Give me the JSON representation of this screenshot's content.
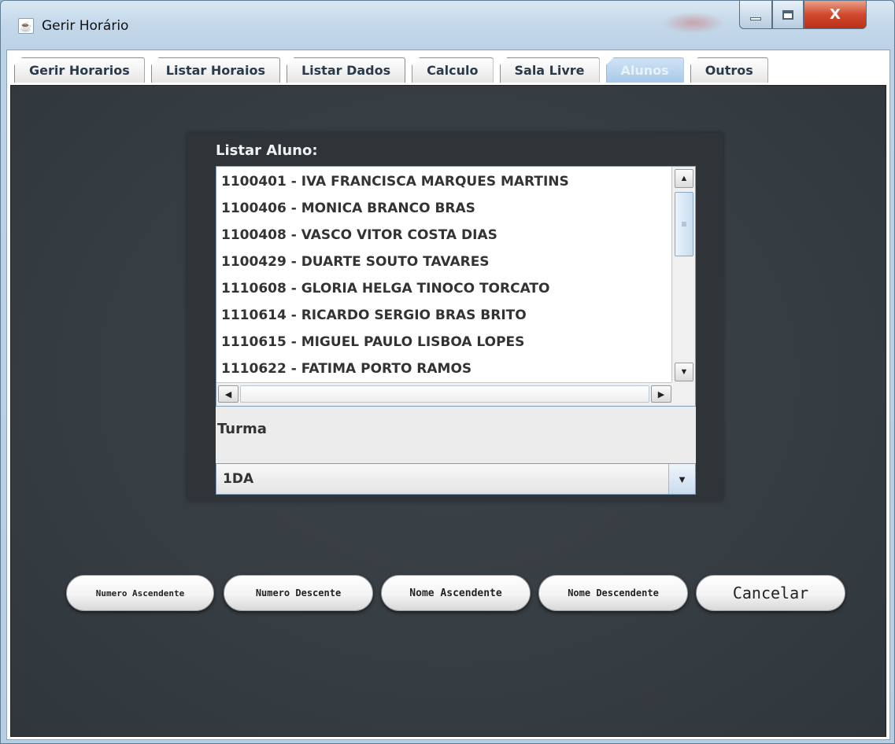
{
  "window": {
    "title": "Gerir Horário",
    "app_icon": "java-coffee-icon",
    "controls": {
      "close_glyph": "X"
    }
  },
  "tabs": [
    {
      "label": "Gerir Horarios",
      "active": false
    },
    {
      "label": "Listar Horaios",
      "active": false
    },
    {
      "label": "Listar Dados",
      "active": false
    },
    {
      "label": "Calculo",
      "active": false
    },
    {
      "label": "Sala Livre",
      "active": false
    },
    {
      "label": "Alunos",
      "active": true
    },
    {
      "label": "Outros",
      "active": false
    }
  ],
  "alunos": {
    "list_label": "Listar Aluno:",
    "students": [
      "1100401 - IVA FRANCISCA MARQUES MARTINS",
      "1100406 - MONICA BRANCO BRAS",
      "1100408 - VASCO VITOR COSTA DIAS",
      "1100429 - DUARTE SOUTO TAVARES",
      "1110608 - GLORIA HELGA TINOCO TORCATO",
      "1110614 - RICARDO SERGIO BRAS BRITO",
      "1110615 - MIGUEL PAULO LISBOA LOPES",
      "1110622 - FATIMA PORTO RAMOS"
    ],
    "turma_label": "Turma",
    "turma_value": "1DA"
  },
  "buttons": {
    "numero_ascendente": "Numero Ascendente",
    "numero_descente": "Numero Descente",
    "nome_ascendente": "Nome Ascendente",
    "nome_descendente": "Nome Descendente",
    "cancelar": "Cancelar"
  },
  "colors": {
    "panel_background": "#363d43",
    "active_tab": "#a9c9e7",
    "close_button": "#d24a2c"
  }
}
